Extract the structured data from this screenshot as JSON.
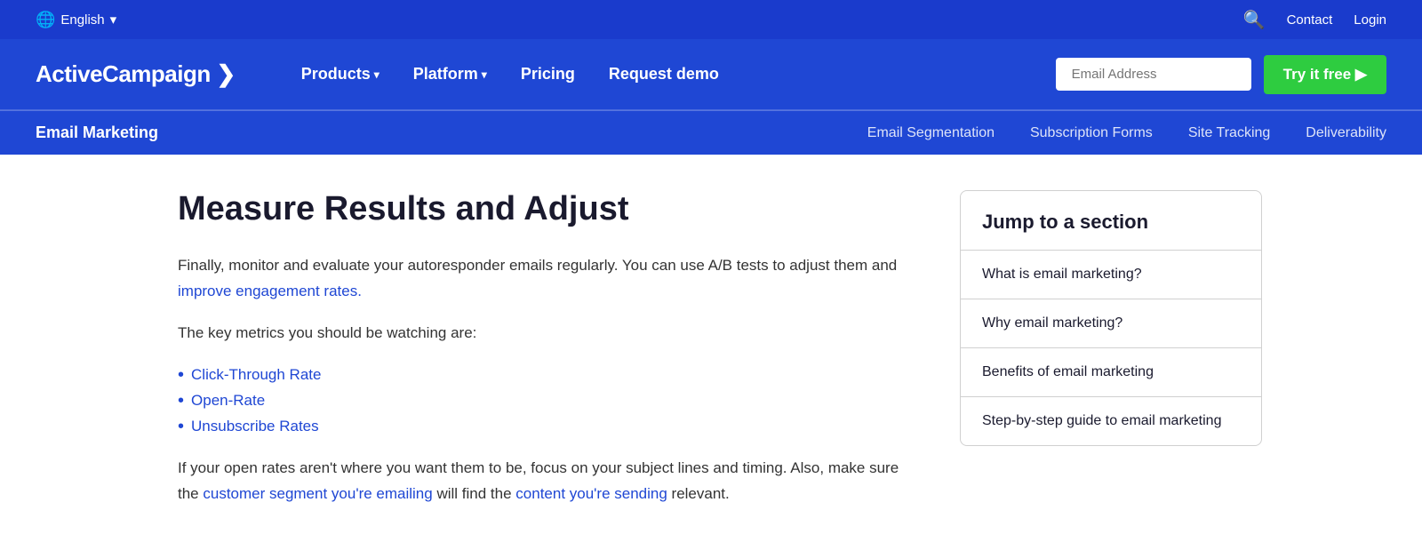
{
  "topbar": {
    "language": "English",
    "chevron": "▾",
    "contact": "Contact",
    "login": "Login"
  },
  "navbar": {
    "logo": "ActiveCampaign ❯",
    "links": [
      {
        "label": "Products",
        "hasChevron": true
      },
      {
        "label": "Platform",
        "hasChevron": true
      },
      {
        "label": "Pricing",
        "hasChevron": false
      },
      {
        "label": "Request demo",
        "hasChevron": false
      }
    ],
    "email_placeholder": "Email Address",
    "try_btn": "Try it free ▶"
  },
  "subnav": {
    "title": "Email Marketing",
    "links": [
      "Email Segmentation",
      "Subscription Forms",
      "Site Tracking",
      "Deliverability"
    ]
  },
  "article": {
    "heading": "Measure Results and Adjust",
    "para1": "Finally, monitor and evaluate your autoresponder emails regularly. You can use A/B tests to adjust them and improve engagement rates.",
    "para2": "The key metrics you should be watching are:",
    "bullets": [
      "Click-Through Rate",
      "Open-Rate",
      "Unsubscribe Rates"
    ],
    "para3": "If your open rates aren't where you want them to be, focus on your subject lines and timing. Also, make sure the customer segment you're emailing will find the content you're sending relevant."
  },
  "jump_section": {
    "title": "Jump to a section",
    "items": [
      "What is email marketing?",
      "Why email marketing?",
      "Benefits of email marketing",
      "Step-by-step guide to email marketing"
    ]
  }
}
